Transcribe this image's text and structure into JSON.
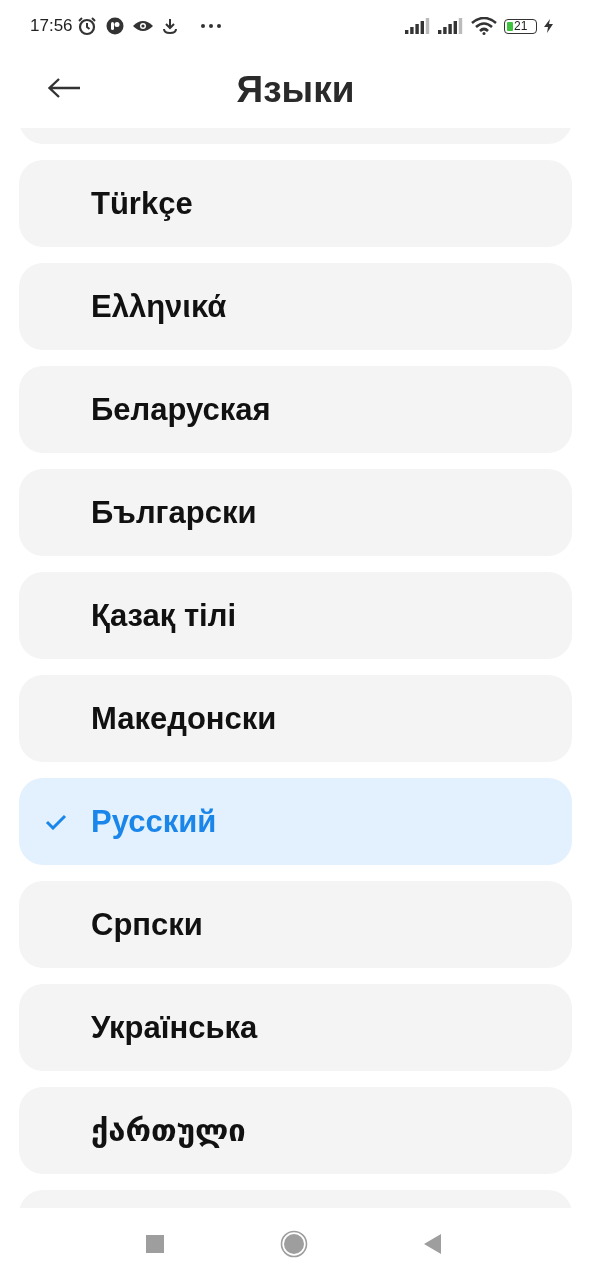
{
  "status_bar": {
    "time": "17:56",
    "battery": "21"
  },
  "header": {
    "title": "Языки"
  },
  "languages": [
    {
      "label": "Türkçe",
      "selected": false
    },
    {
      "label": "Ελληνικά",
      "selected": false
    },
    {
      "label": "Беларуская",
      "selected": false
    },
    {
      "label": "Български",
      "selected": false
    },
    {
      "label": "Қазақ тілі",
      "selected": false
    },
    {
      "label": "Македонски",
      "selected": false
    },
    {
      "label": "Русский",
      "selected": true
    },
    {
      "label": "Српски",
      "selected": false
    },
    {
      "label": "Українська",
      "selected": false
    },
    {
      "label": "ქართული",
      "selected": false
    }
  ]
}
